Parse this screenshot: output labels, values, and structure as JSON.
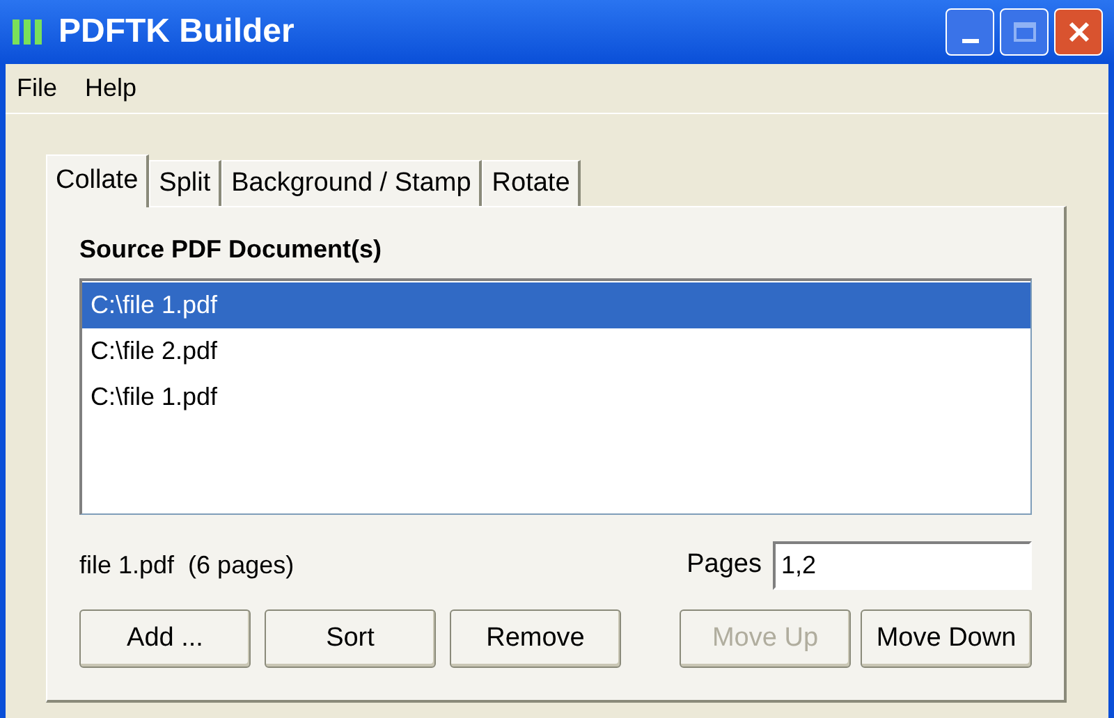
{
  "window": {
    "title": "PDFTK Builder"
  },
  "menu": [
    "File",
    "Help"
  ],
  "tabs": [
    {
      "label": "Collate",
      "selected": true
    },
    {
      "label": "Split",
      "selected": false
    },
    {
      "label": "Background / Stamp",
      "selected": false
    },
    {
      "label": "Rotate",
      "selected": false
    }
  ],
  "source_label": "Source PDF Document(s)",
  "files": [
    {
      "name": "C:\\file 1.pdf",
      "selected": true
    },
    {
      "name": "C:\\file 2.pdf",
      "selected": false
    },
    {
      "name": "C:\\file 1.pdf",
      "selected": false
    }
  ],
  "file_info": "file 1.pdf  (6 pages)",
  "pages": {
    "label": "Pages",
    "value": "1,2"
  },
  "buttons": [
    {
      "label": "Add ...",
      "disabled": false
    },
    {
      "label": "Sort",
      "disabled": false
    },
    {
      "label": "Remove",
      "disabled": false
    },
    {
      "label": "Move Up",
      "disabled": true
    },
    {
      "label": "Move Down",
      "disabled": false
    }
  ]
}
